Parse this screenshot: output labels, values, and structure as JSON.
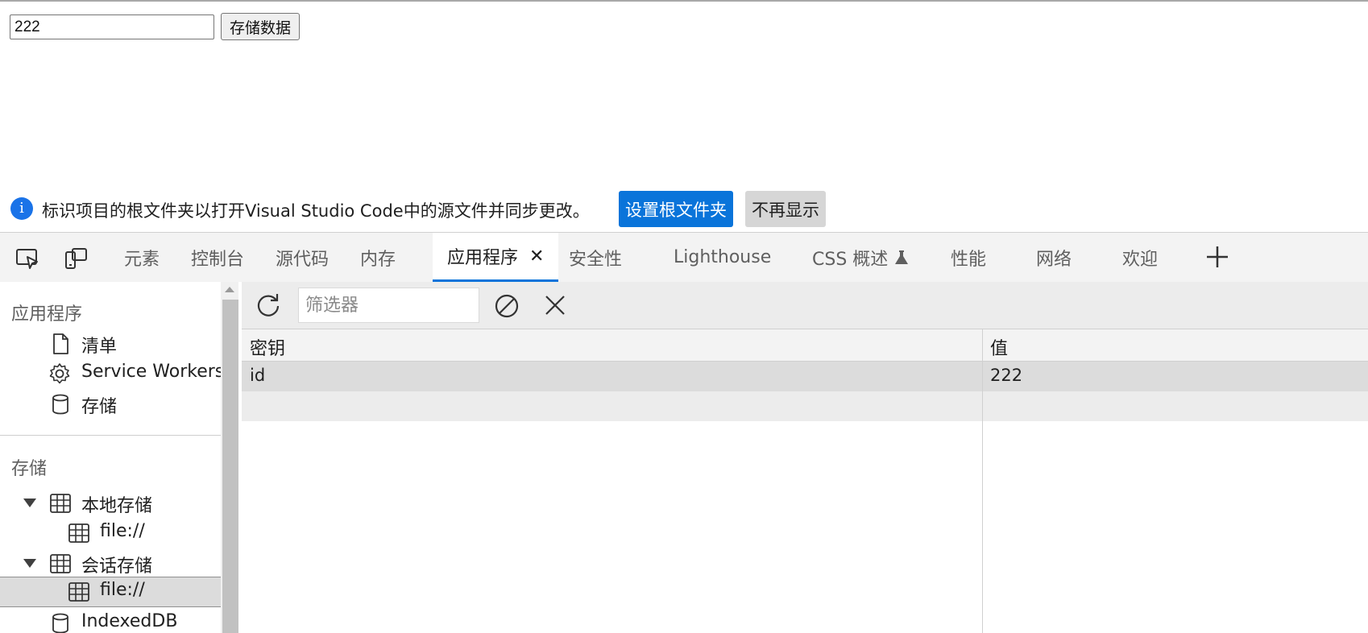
{
  "page": {
    "input_value": "222",
    "store_button": "存储数据"
  },
  "infobar": {
    "message": "标识项目的根文件夹以打开Visual Studio Code中的源文件并同步更改。",
    "primary_button": "设置根文件夹",
    "secondary_button": "不再显示",
    "accent": "#0a74da"
  },
  "tabs": [
    {
      "label": "元素"
    },
    {
      "label": "控制台"
    },
    {
      "label": "源代码"
    },
    {
      "label": "内存"
    },
    {
      "label": "应用程序",
      "active": true
    },
    {
      "label": "安全性"
    },
    {
      "label": "Lighthouse"
    },
    {
      "label": "CSS 概述"
    },
    {
      "label": "性能"
    },
    {
      "label": "网络"
    },
    {
      "label": "欢迎"
    }
  ],
  "sidebar": {
    "app_section": "应用程序",
    "app_items": [
      "清单",
      "Service Workers",
      "存储"
    ],
    "storage_section": "存储",
    "local_storage": "本地存储",
    "local_storage_child": "file://",
    "session_storage": "会话存储",
    "session_storage_child": "file://",
    "indexeddb": "IndexedDB"
  },
  "panel": {
    "filter_placeholder": "筛选器",
    "columns": {
      "key": "密钥",
      "value": "值"
    },
    "rows": [
      {
        "key": "id",
        "value": "222"
      }
    ]
  }
}
